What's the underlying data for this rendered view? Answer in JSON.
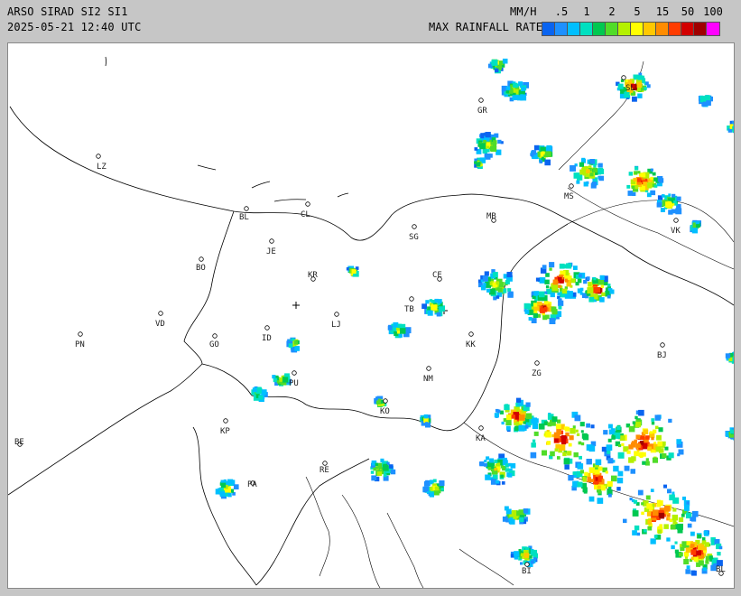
{
  "header": {
    "station": "ARSO SIRAD SI2 SI1",
    "timestamp": "2025-05-21 12:40 UTC",
    "unit": "MM/H",
    "legend_title": "MAX RAINFALL RATE"
  },
  "legend": {
    "ticks": [
      ".5",
      "1",
      "2",
      "5",
      "15",
      "50",
      "100"
    ],
    "colors": [
      "#0a64f0",
      "#1e90ff",
      "#00bfff",
      "#00e0c0",
      "#00c850",
      "#50dc28",
      "#b4f000",
      "#ffff00",
      "#ffc800",
      "#ff8c00",
      "#ff3c00",
      "#d20000",
      "#a00000",
      "#ff00ff"
    ]
  },
  "cities": [
    {
      "code": "LZ"
    },
    {
      "code": "GR"
    },
    {
      "code": "SL"
    },
    {
      "code": "BL"
    },
    {
      "code": "CL"
    },
    {
      "code": "MB"
    },
    {
      "code": "MS"
    },
    {
      "code": "VK"
    },
    {
      "code": "SG"
    },
    {
      "code": "JE"
    },
    {
      "code": "BO"
    },
    {
      "code": "KR"
    },
    {
      "code": "CE"
    },
    {
      "code": "VD"
    },
    {
      "code": "LJ"
    },
    {
      "code": "TB"
    },
    {
      "code": "PN"
    },
    {
      "code": "GO"
    },
    {
      "code": "ID"
    },
    {
      "code": "KK"
    },
    {
      "code": "BJ"
    },
    {
      "code": "NM"
    },
    {
      "code": "ZG"
    },
    {
      "code": "PU"
    },
    {
      "code": "KO"
    },
    {
      "code": "KP"
    },
    {
      "code": "KA"
    },
    {
      "code": "BE"
    },
    {
      "code": "RE"
    },
    {
      "code": "PA"
    },
    {
      "code": "BI"
    },
    {
      "code": "BL"
    }
  ]
}
